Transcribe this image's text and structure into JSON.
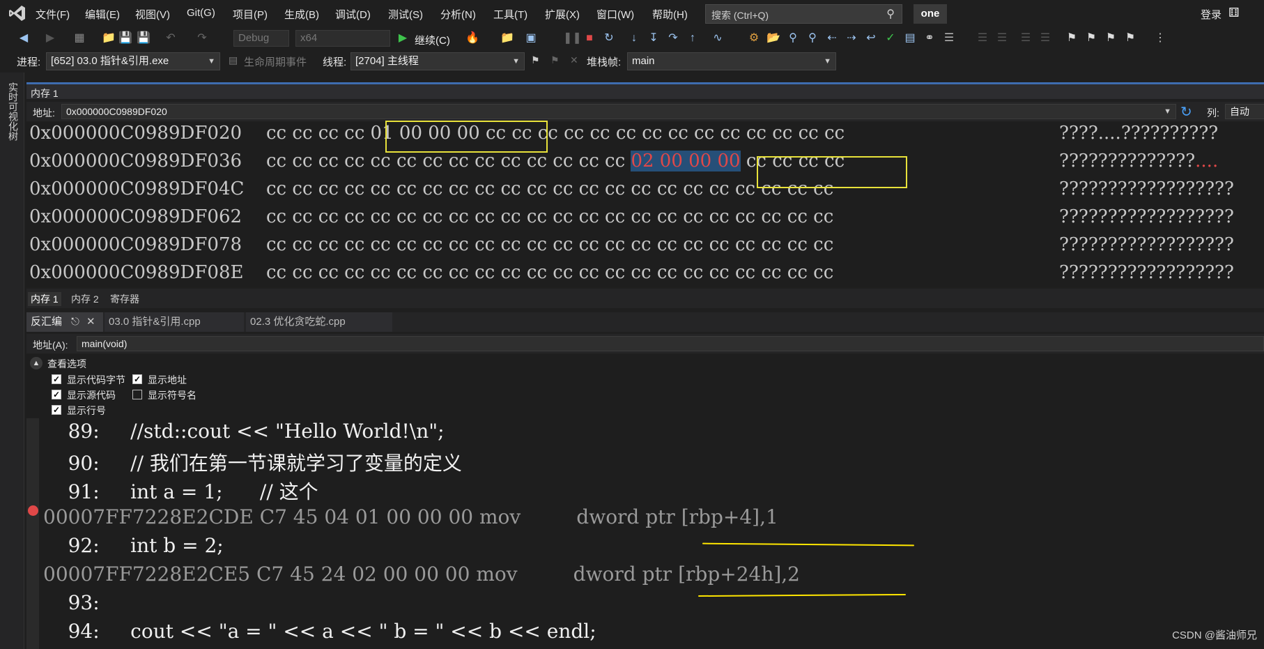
{
  "menu": {
    "items": [
      "文件(F)",
      "编辑(E)",
      "视图(V)",
      "Git(G)",
      "项目(P)",
      "生成(B)",
      "调试(D)",
      "测试(S)",
      "分析(N)",
      "工具(T)",
      "扩展(X)",
      "窗口(W)",
      "帮助(H)"
    ],
    "search_placeholder": "搜索 (Ctrl+Q)",
    "solution_name": "one",
    "login": "登录"
  },
  "toolbar": {
    "config": "Debug",
    "platform": "x64",
    "continue_label": "继续(C)"
  },
  "debug_location": {
    "process_label": "进程:",
    "process_value": "[652] 03.0 指针&引用.exe",
    "lifecycle_label": "生命周期事件",
    "thread_label": "线程:",
    "thread_value": "[2704] 主线程",
    "stackframe_label": "堆栈帧:",
    "stackframe_value": "main"
  },
  "left_strip": {
    "label": "实时可视化树"
  },
  "memory": {
    "title": "内存 1",
    "address_label": "地址:",
    "address_value": "0x000000C0989DF020",
    "columns_label": "列:",
    "columns_value": "自动",
    "rows": [
      {
        "addr": "0x000000C0989DF020",
        "bytes": "cc cc cc cc 01 00 00 00 cc cc cc cc cc cc cc cc cc cc cc cc cc cc",
        "ascii": "????....??????????"
      },
      {
        "addr": "0x000000C0989DF036",
        "bytes_pre": "cc cc cc cc cc cc cc cc cc cc cc cc cc cc ",
        "bytes_hl": "02 00 00 00",
        "bytes_post": " cc cc cc cc",
        "ascii_pre": "??????????????",
        "ascii_hl": "...."
      },
      {
        "addr": "0x000000C0989DF04C",
        "bytes": "cc cc cc cc cc cc cc cc cc cc cc cc cc cc cc cc cc cc cc cc cc cc",
        "ascii": "??????????????????"
      },
      {
        "addr": "0x000000C0989DF062",
        "bytes": "cc cc cc cc cc cc cc cc cc cc cc cc cc cc cc cc cc cc cc cc cc cc",
        "ascii": "??????????????????"
      },
      {
        "addr": "0x000000C0989DF078",
        "bytes": "cc cc cc cc cc cc cc cc cc cc cc cc cc cc cc cc cc cc cc cc cc cc",
        "ascii": "??????????????????"
      },
      {
        "addr": "0x000000C0989DF08E",
        "bytes": "cc cc cc cc cc cc cc cc cc cc cc cc cc cc cc cc cc cc cc cc cc cc",
        "ascii": "??????????????????"
      }
    ],
    "tabs": [
      "内存 1",
      "内存 2",
      "寄存器"
    ]
  },
  "disasm": {
    "tab_title": "反汇编",
    "file_tabs": [
      "03.0 指针&引用.cpp",
      "02.3 优化贪吃蛇.cpp"
    ],
    "address_label": "地址(A):",
    "address_value": "main(void)",
    "options_title": "查看选项",
    "options": {
      "show_code_bytes": "显示代码字节",
      "show_address": "显示地址",
      "show_source": "显示源代码",
      "show_symbol_names": "显示符号名",
      "show_line_numbers": "显示行号"
    },
    "lines": [
      {
        "kind": "src",
        "text": "    89:     //std::cout << \"Hello World!\\n\";"
      },
      {
        "kind": "src",
        "text": "    90:     // 我们在第一节课就学习了变量的定义"
      },
      {
        "kind": "src",
        "text": "    91:     int a = 1;      // 这个"
      },
      {
        "kind": "asm",
        "text": "00007FF7228E2CDE C7 45 04 01 00 00 00 mov         dword ptr [rbp+4],1"
      },
      {
        "kind": "src",
        "text": "    92:     int b = 2;"
      },
      {
        "kind": "asm",
        "text": "00007FF7228E2CE5 C7 45 24 02 00 00 00 mov         dword ptr [rbp+24h],2"
      },
      {
        "kind": "src",
        "text": "    93:"
      },
      {
        "kind": "src",
        "text": "    94:     cout << \"a = \" << a << \" b = \" << b << endl;"
      }
    ]
  },
  "watermark": "CSDN @酱油师兄"
}
